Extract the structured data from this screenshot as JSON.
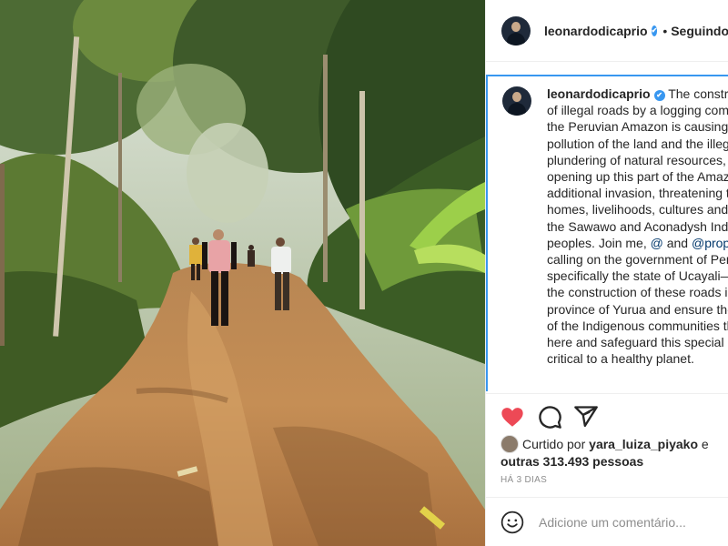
{
  "post": {
    "username": "leonardodicaprio",
    "verified_badge": "✔",
    "follow_separator": "•",
    "follow_label": "Seguindo",
    "caption_parts": [
      "The construction of illegal roads by a logging company in the Peruvian Amazon is causing pollution of the land and the illegal plundering of natural resources, opening up this part of the Amazon to additional invasion, threatening the homes, livelihoods, cultures and lives of the Sawawo and Aconadysh Indigenous peoples. Join me, ",
      "@",
      " and ",
      "@propurus",
      " in calling on the government of Peru—specifically the state of Ucayali—to stop the construction of these roads in the province of Yurua and ensure the safety of the Indigenous communities that live here and safeguard this special place, critical to a healthy planet."
    ],
    "likes_prefix": "Curtido por ",
    "likes_user": "yara_luiza_piyako",
    "likes_middle": " e ",
    "likes_others": "outras 313.493 pessoas",
    "time_label": "HÁ 3 DIAS",
    "comment_placeholder": "Adicione um comentário..."
  },
  "icons": {
    "avatar": "avatar-photo",
    "like": "heart-icon",
    "comment": "comment-icon",
    "share": "share-icon",
    "emoji": "emoji-icon"
  },
  "colors": {
    "like_red": "#ed4956",
    "verified_blue": "#3897f0",
    "mention_blue": "#00376b",
    "focus_border": "#3897f0"
  }
}
